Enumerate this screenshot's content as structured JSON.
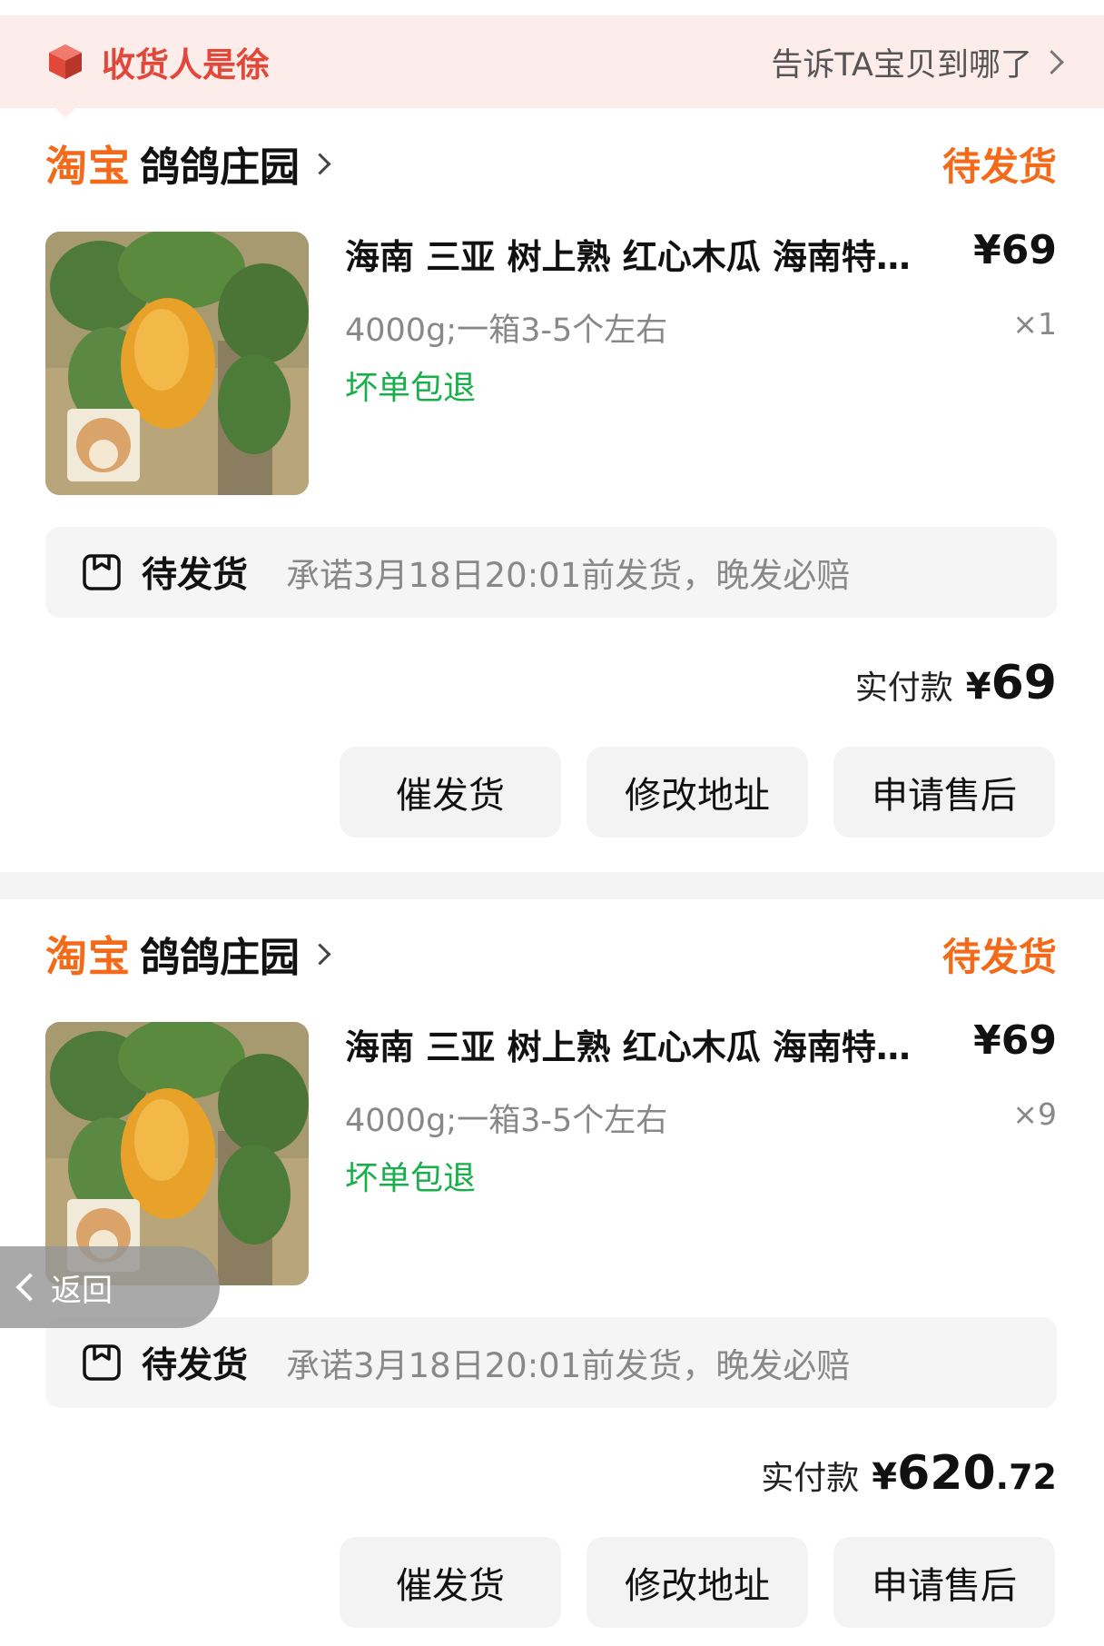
{
  "recipient_bar": {
    "name": "收货人是徐",
    "link": "告诉TA宝贝到哪了",
    "icon": "package-box-icon",
    "color": "#e2483a"
  },
  "orders": [
    {
      "platform": "淘宝",
      "shop": "鸽鸽庄园",
      "status": "待发货",
      "product": {
        "title": "海南 三亚 树上熟 红心木瓜 海南特…",
        "price": "¥69",
        "spec": "4000g;一箱3-5个左右",
        "qty": "×1",
        "tag": "坏单包退"
      },
      "shipping": {
        "status": "待发货",
        "note": "承诺3月18日20:01前发货，晚发必赔"
      },
      "paid": {
        "label": "实付款",
        "currency": "¥",
        "integer": "69",
        "decimal": ""
      },
      "buttons": [
        "催发货",
        "修改地址",
        "申请售后"
      ]
    },
    {
      "platform": "淘宝",
      "shop": "鸽鸽庄园",
      "status": "待发货",
      "product": {
        "title": "海南 三亚 树上熟 红心木瓜 海南特…",
        "price": "¥69",
        "spec": "4000g;一箱3-5个左右",
        "qty": "×9",
        "tag": "坏单包退"
      },
      "shipping": {
        "status": "待发货",
        "note": "承诺3月18日20:01前发货，晚发必赔"
      },
      "paid": {
        "label": "实付款",
        "currency": "¥",
        "integer": "620",
        "decimal": ".72"
      },
      "buttons": [
        "催发货",
        "修改地址",
        "申请售后"
      ]
    }
  ],
  "back_button": {
    "label": "返回"
  },
  "colors": {
    "accent_orange": "#f46a19",
    "green_tag": "#18b04a",
    "status_red": "#e2483a"
  }
}
